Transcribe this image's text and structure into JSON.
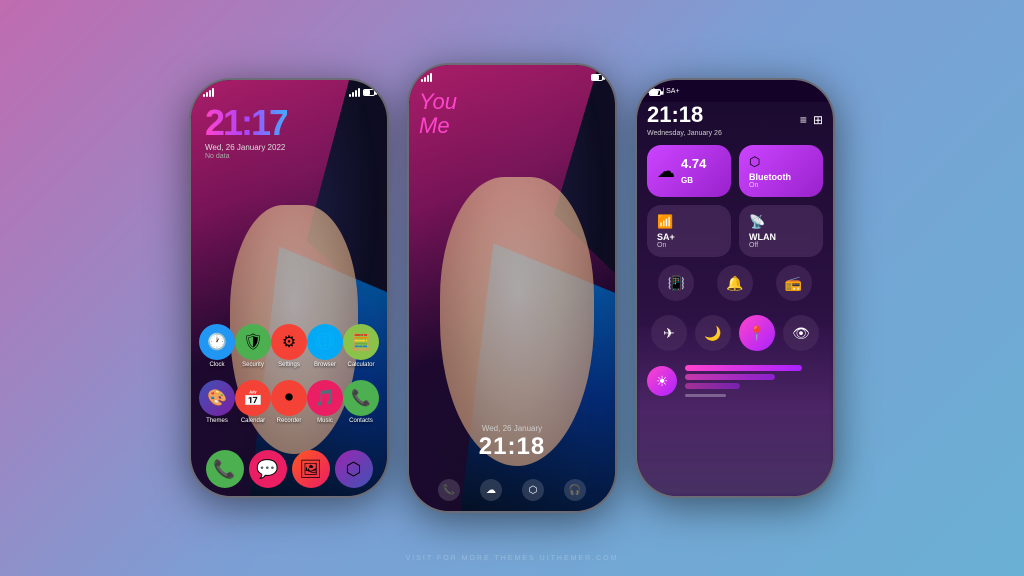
{
  "background": {
    "gradient_start": "#c06bb0",
    "gradient_end": "#6ab0d4"
  },
  "watermark": {
    "text": "VISIT FOR MORE THEMES UITHEMER.COM"
  },
  "phone1": {
    "clock": {
      "time": "21:17",
      "date": "Wed, 26 January 2022",
      "no_data": "No data"
    },
    "apps_row1": [
      {
        "label": "Clock",
        "color": "#2196F3",
        "icon": "🕐"
      },
      {
        "label": "Security",
        "color": "#4CAF50",
        "icon": "🛡"
      },
      {
        "label": "Settings",
        "color": "#F44336",
        "icon": "⚙"
      },
      {
        "label": "Browser",
        "color": "#03A9F4",
        "icon": "🌐"
      },
      {
        "label": "Calculator",
        "color": "#8BC34A",
        "icon": "🧮"
      }
    ],
    "apps_row2": [
      {
        "label": "Themes",
        "color": "#3F51B5",
        "icon": "🎨"
      },
      {
        "label": "Calendar",
        "color": "#F44336",
        "icon": "📅"
      },
      {
        "label": "Recorder",
        "color": "#F44336",
        "icon": "⏺"
      },
      {
        "label": "Music",
        "color": "#E91E63",
        "icon": "🎵"
      },
      {
        "label": "Contacts",
        "color": "#4CAF50",
        "icon": "📞"
      }
    ],
    "dock": [
      {
        "label": "Phone",
        "color": "#4CAF50",
        "icon": "📞"
      },
      {
        "label": "Messages",
        "color": "#E91E63",
        "icon": "💬"
      },
      {
        "label": "Gallery",
        "color": "#FF5722",
        "icon": "🖼"
      },
      {
        "label": "Apps",
        "color": "#9C27B0",
        "icon": "⬡"
      }
    ]
  },
  "phone2": {
    "logo_line1": "Yo",
    "logo_line2": "u",
    "logo_line3": "Me",
    "date": "Wed, 26 January",
    "time": "21:18"
  },
  "phone3": {
    "sa_label": "SA+ | SA+",
    "time": "21:18",
    "date": "Wednesday, January 26",
    "tiles": [
      {
        "id": "data",
        "icon": "☁",
        "value": "4.74",
        "unit": "GB",
        "label": "",
        "active": true
      },
      {
        "id": "bluetooth",
        "icon": "🔵",
        "label": "Bluetooth",
        "sublabel": "On",
        "active": true
      },
      {
        "id": "sa_plus",
        "icon": "📶",
        "label": "SA+",
        "sublabel": "On",
        "active": true
      },
      {
        "id": "wlan",
        "icon": "📡",
        "label": "WLAN",
        "sublabel": "Off",
        "active": false
      }
    ],
    "quick_toggles": [
      {
        "icon": "📳",
        "active": false
      },
      {
        "icon": "🔔",
        "active": false
      },
      {
        "icon": "📻",
        "active": false
      }
    ],
    "action_toggles": [
      {
        "icon": "✈",
        "active": false
      },
      {
        "icon": "🌙",
        "active": false
      },
      {
        "icon": "📍",
        "active": true
      },
      {
        "icon": "👁",
        "active": false
      }
    ],
    "brightness": {
      "icon": "☀"
    }
  }
}
